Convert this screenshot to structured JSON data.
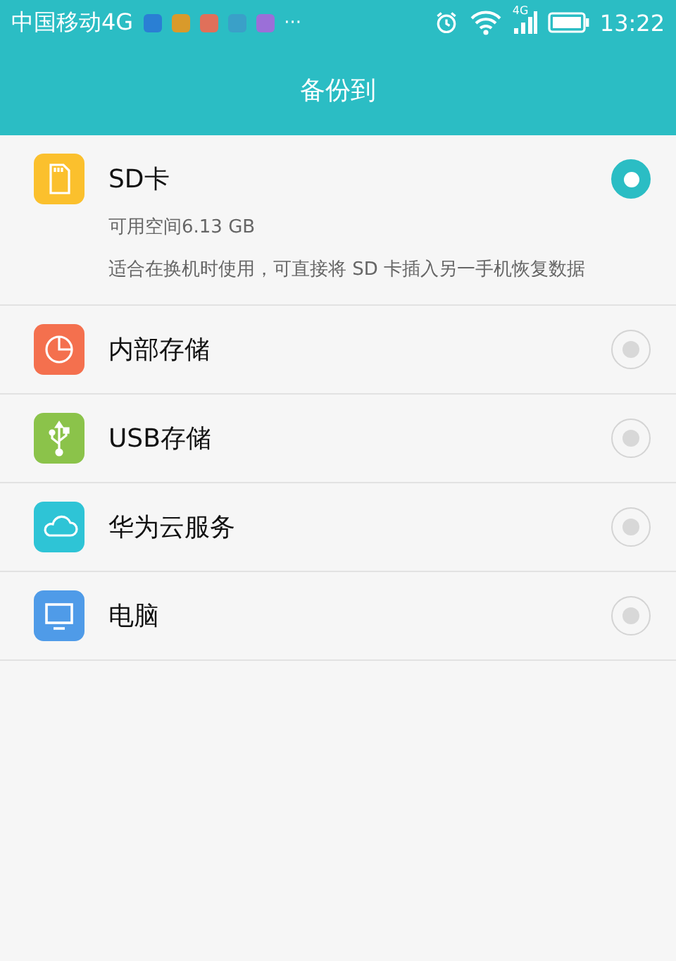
{
  "status_bar": {
    "carrier": "中国移动4G",
    "notifications": [
      {
        "color": "#2a7fd4"
      },
      {
        "color": "#d99a2b"
      },
      {
        "color": "#e0705a"
      },
      {
        "color": "#3aa0c8"
      },
      {
        "color": "#9b6fd8"
      }
    ],
    "more": "···",
    "network_label": "4G",
    "time": "13:22"
  },
  "header": {
    "title": "备份到"
  },
  "options": [
    {
      "kind": "sd",
      "color": "#fbc02d",
      "label": "SD卡",
      "selected": true,
      "details": [
        "可用空间6.13 GB",
        "适合在换机时使用，可直接将 SD 卡插入另一手机恢复数据"
      ]
    },
    {
      "kind": "pie",
      "color": "#f4704e",
      "label": "内部存储",
      "selected": false
    },
    {
      "kind": "usb",
      "color": "#8bc34a",
      "label": "USB存储",
      "selected": false
    },
    {
      "kind": "cloud",
      "color": "#2ec4d6",
      "label": "华为云服务",
      "selected": false
    },
    {
      "kind": "monitor",
      "color": "#4f9be8",
      "label": "电脑",
      "selected": false
    }
  ]
}
